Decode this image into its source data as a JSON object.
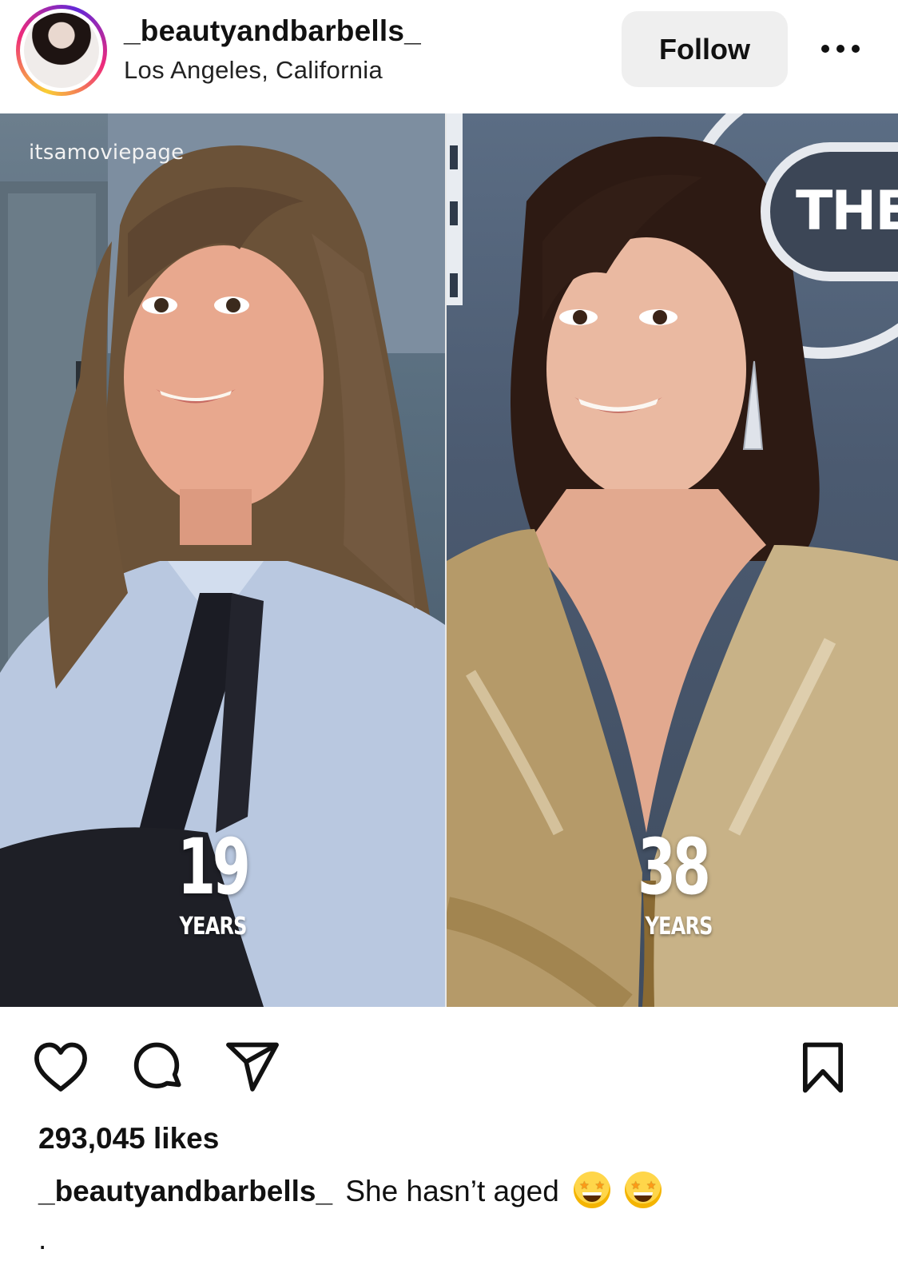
{
  "header": {
    "username": "_beautyandbarbells_",
    "location": "Los Angeles, California",
    "follow_label": "Follow"
  },
  "post": {
    "watermark": "itsamoviepage",
    "left_panel": {
      "age": "19",
      "unit": "YEARS"
    },
    "right_panel": {
      "age": "38",
      "unit": "YEARS",
      "backdrop_text": "THE"
    }
  },
  "actions": {
    "icons": [
      "heart-icon",
      "comment-icon",
      "share-icon",
      "bookmark-icon"
    ]
  },
  "likes_text": "293,045 likes",
  "caption": {
    "username": "_beautyandbarbells_",
    "text": "She hasn’t aged",
    "emojis": [
      "star-struck-emoji",
      "star-struck-emoji"
    ],
    "trailing": "."
  }
}
